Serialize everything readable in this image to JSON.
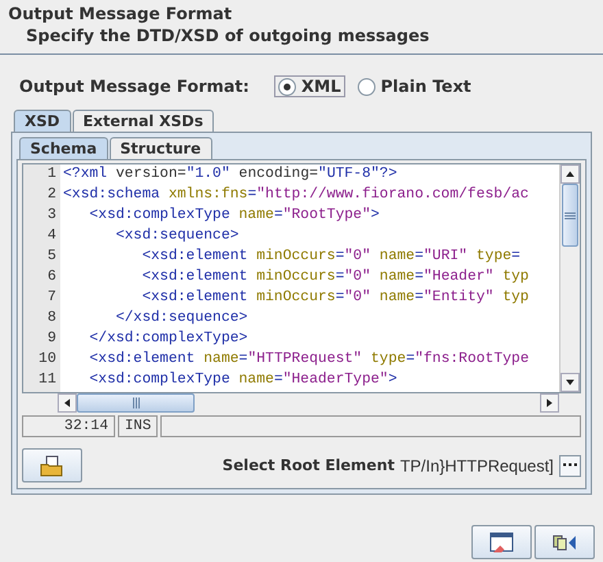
{
  "header": {
    "title": "Output Message Format",
    "subtitle": "Specify the DTD/XSD of outgoing messages"
  },
  "format": {
    "label": "Output Message Format:",
    "options": [
      {
        "label": "XML",
        "selected": true
      },
      {
        "label": "Plain Text",
        "selected": false
      }
    ]
  },
  "outer_tabs": [
    {
      "label": "XSD",
      "selected": true
    },
    {
      "label": "External XSDs",
      "selected": false
    }
  ],
  "inner_tabs": [
    {
      "label": "Schema",
      "selected": true
    },
    {
      "label": "Structure",
      "selected": false
    }
  ],
  "editor": {
    "lines": [
      {
        "number": "1",
        "tokens": [
          {
            "kind": "tag",
            "text": "<?xml"
          },
          {
            "kind": "plain",
            "text": " version="
          },
          {
            "kind": "tag",
            "text": "\"1.0\""
          },
          {
            "kind": "plain",
            "text": " encoding="
          },
          {
            "kind": "tag",
            "text": "\"UTF-8\"?>"
          }
        ]
      },
      {
        "number": "2",
        "tokens": [
          {
            "kind": "tag",
            "text": "<xsd:schema"
          },
          {
            "kind": "attr",
            "text": " xmlns:fns"
          },
          {
            "kind": "tag",
            "text": "="
          },
          {
            "kind": "value",
            "text": "\"http://www.fiorano.com/fesb/ac"
          }
        ]
      },
      {
        "number": "3",
        "tokens": [
          {
            "kind": "tag",
            "text": "   <xsd:complexType"
          },
          {
            "kind": "attr",
            "text": " name"
          },
          {
            "kind": "tag",
            "text": "="
          },
          {
            "kind": "value",
            "text": "\"RootType\""
          },
          {
            "kind": "tag",
            "text": ">"
          }
        ]
      },
      {
        "number": "4",
        "tokens": [
          {
            "kind": "tag",
            "text": "      <xsd:sequence>"
          }
        ]
      },
      {
        "number": "5",
        "tokens": [
          {
            "kind": "tag",
            "text": "         <xsd:element"
          },
          {
            "kind": "attr",
            "text": " minOccurs"
          },
          {
            "kind": "tag",
            "text": "="
          },
          {
            "kind": "value",
            "text": "\"0\""
          },
          {
            "kind": "attr",
            "text": " name"
          },
          {
            "kind": "tag",
            "text": "="
          },
          {
            "kind": "value",
            "text": "\"URI\""
          },
          {
            "kind": "attr",
            "text": " type"
          },
          {
            "kind": "tag",
            "text": "="
          }
        ]
      },
      {
        "number": "6",
        "tokens": [
          {
            "kind": "tag",
            "text": "         <xsd:element"
          },
          {
            "kind": "attr",
            "text": " minOccurs"
          },
          {
            "kind": "tag",
            "text": "="
          },
          {
            "kind": "value",
            "text": "\"0\""
          },
          {
            "kind": "attr",
            "text": " name"
          },
          {
            "kind": "tag",
            "text": "="
          },
          {
            "kind": "value",
            "text": "\"Header\""
          },
          {
            "kind": "attr",
            "text": " typ"
          }
        ]
      },
      {
        "number": "7",
        "tokens": [
          {
            "kind": "tag",
            "text": "         <xsd:element"
          },
          {
            "kind": "attr",
            "text": " minOccurs"
          },
          {
            "kind": "tag",
            "text": "="
          },
          {
            "kind": "value",
            "text": "\"0\""
          },
          {
            "kind": "attr",
            "text": " name"
          },
          {
            "kind": "tag",
            "text": "="
          },
          {
            "kind": "value",
            "text": "\"Entity\""
          },
          {
            "kind": "attr",
            "text": " typ"
          }
        ]
      },
      {
        "number": "8",
        "tokens": [
          {
            "kind": "tag",
            "text": "      </xsd:sequence>"
          }
        ]
      },
      {
        "number": "9",
        "tokens": [
          {
            "kind": "tag",
            "text": "   </xsd:complexType>"
          }
        ]
      },
      {
        "number": "10",
        "tokens": [
          {
            "kind": "tag",
            "text": "   <xsd:element"
          },
          {
            "kind": "attr",
            "text": " name"
          },
          {
            "kind": "tag",
            "text": "="
          },
          {
            "kind": "value",
            "text": "\"HTTPRequest\""
          },
          {
            "kind": "attr",
            "text": " type"
          },
          {
            "kind": "tag",
            "text": "="
          },
          {
            "kind": "value",
            "text": "\"fns:RootType"
          }
        ]
      },
      {
        "number": "11",
        "tokens": [
          {
            "kind": "tag",
            "text": "   <xsd:complexType"
          },
          {
            "kind": "attr",
            "text": " name"
          },
          {
            "kind": "tag",
            "text": "="
          },
          {
            "kind": "value",
            "text": "\"HeaderType\""
          },
          {
            "kind": "tag",
            "text": ">"
          }
        ]
      }
    ]
  },
  "status": {
    "position": "32:14",
    "mode": "INS"
  },
  "root_element": {
    "label": "Select Root Element",
    "value": "TP/In}HTTPRequest]"
  }
}
